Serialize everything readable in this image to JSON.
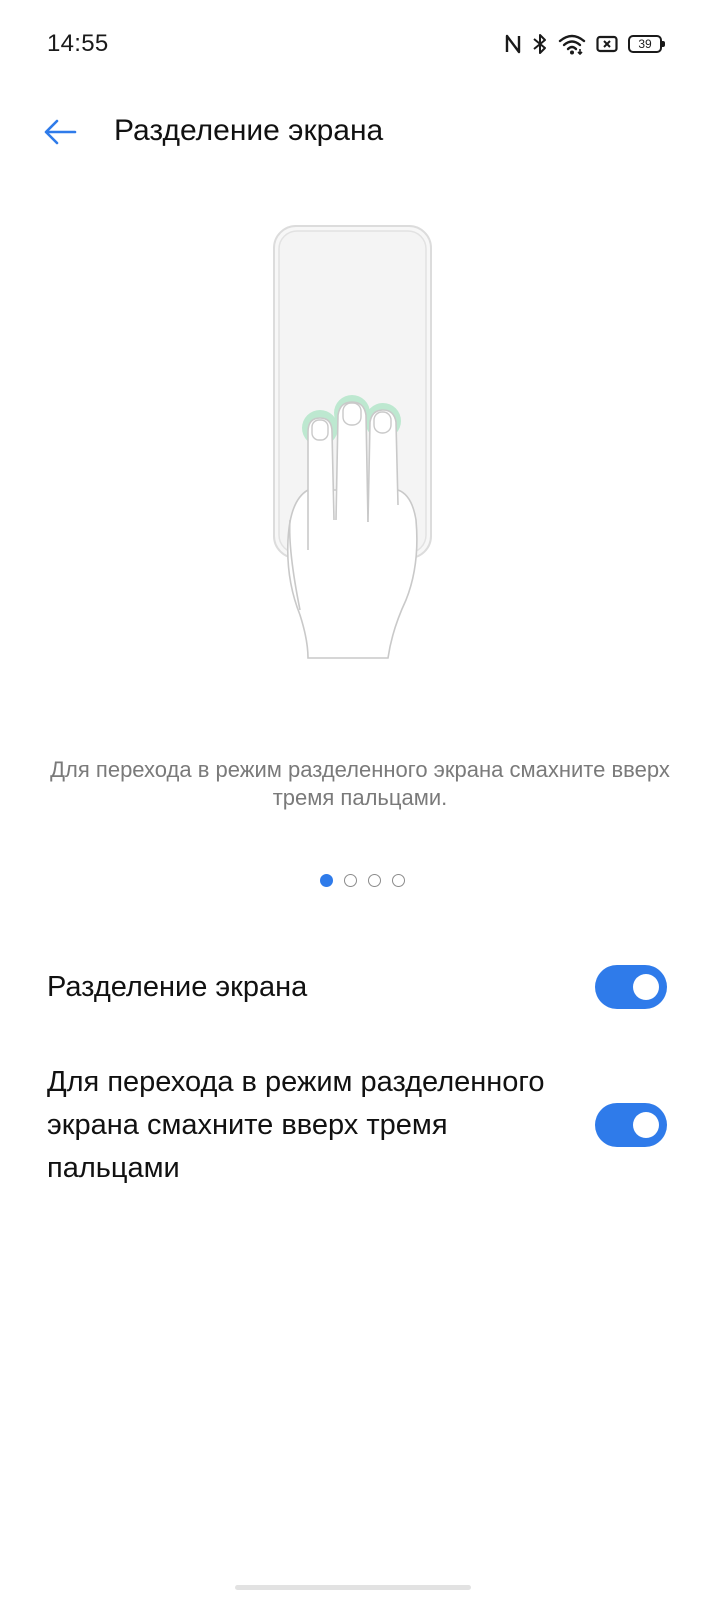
{
  "status_bar": {
    "time": "14:55",
    "battery_level": "39",
    "icons": [
      "nfc-icon",
      "bluetooth-icon",
      "wifi-icon",
      "sim-icon",
      "battery-icon"
    ]
  },
  "header": {
    "title": "Разделение экрана",
    "back_icon": "arrow-left-icon"
  },
  "tutorial": {
    "description": "Для перехода в режим разделенного экрана смахните вверх тремя пальцами.",
    "page_count": 4,
    "active_page": 1
  },
  "settings": [
    {
      "label": "Разделение экрана",
      "enabled": true
    },
    {
      "label": "Для перехода в режим разделенного экрана смахните вверх тремя пальцами",
      "enabled": true
    }
  ],
  "colors": {
    "accent": "#2f7bea",
    "touch_highlight": "#bde8d0",
    "description_text": "#7a7a7a"
  }
}
